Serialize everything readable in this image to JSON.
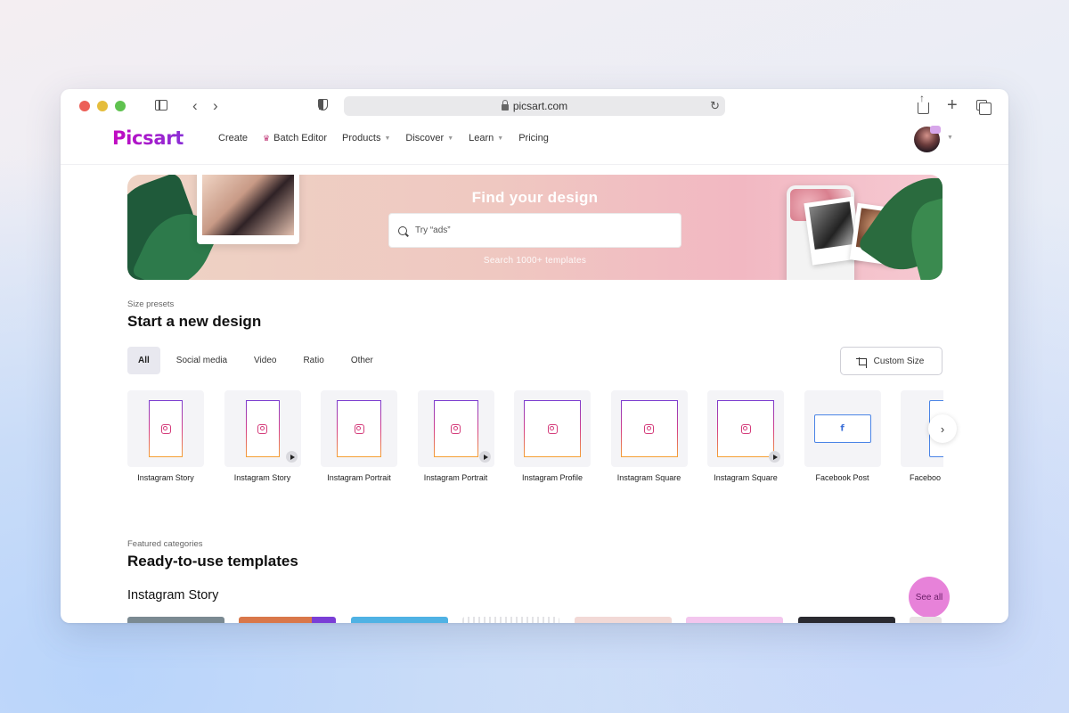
{
  "browser": {
    "url": "picsart.com"
  },
  "nav": {
    "logo": "Picsart",
    "items": [
      {
        "label": "Create",
        "caret": false
      },
      {
        "label": "Batch Editor",
        "caret": false,
        "icon": "crown-icon"
      },
      {
        "label": "Products",
        "caret": true
      },
      {
        "label": "Discover",
        "caret": true
      },
      {
        "label": "Learn",
        "caret": true
      },
      {
        "label": "Pricing",
        "caret": false
      }
    ]
  },
  "banner": {
    "title": "Find your design",
    "search_placeholder": "Try “ads”",
    "subtitle": "Search 1000+ templates"
  },
  "presets_section": {
    "eyebrow": "Size presets",
    "title": "Start a new design",
    "filters": [
      "All",
      "Social media",
      "Video",
      "Ratio",
      "Other"
    ],
    "active_filter": "All",
    "custom_size_label": "Custom Size",
    "items": [
      {
        "label": "Instagram Story",
        "shape": "story",
        "video": false
      },
      {
        "label": "Instagram Story",
        "shape": "story",
        "video": true
      },
      {
        "label": "Instagram Portrait",
        "shape": "portrait",
        "video": false
      },
      {
        "label": "Instagram Portrait",
        "shape": "portrait",
        "video": true
      },
      {
        "label": "Instagram Profile",
        "shape": "square",
        "video": false
      },
      {
        "label": "Instagram Square",
        "shape": "square",
        "video": false
      },
      {
        "label": "Instagram Square",
        "shape": "square",
        "video": true
      },
      {
        "label": "Facebook Post",
        "shape": "fb",
        "video": false
      },
      {
        "label": "Faceboo",
        "shape": "fb-tall",
        "video": false
      }
    ]
  },
  "templates_section": {
    "eyebrow": "Featured categories",
    "title": "Ready-to-use templates",
    "category": "Instagram Story",
    "see_all_label": "See all",
    "thumb_colors": [
      "#7b8a92",
      "#d9774a",
      "#4fb2e4",
      "#e9e9ec",
      "#f2d9d6",
      "#f3c6ee",
      "#2a2a30",
      "#e8e2e4"
    ]
  },
  "colors": {
    "brand": "#c209c1",
    "see_all_bg": "#e782d9"
  }
}
